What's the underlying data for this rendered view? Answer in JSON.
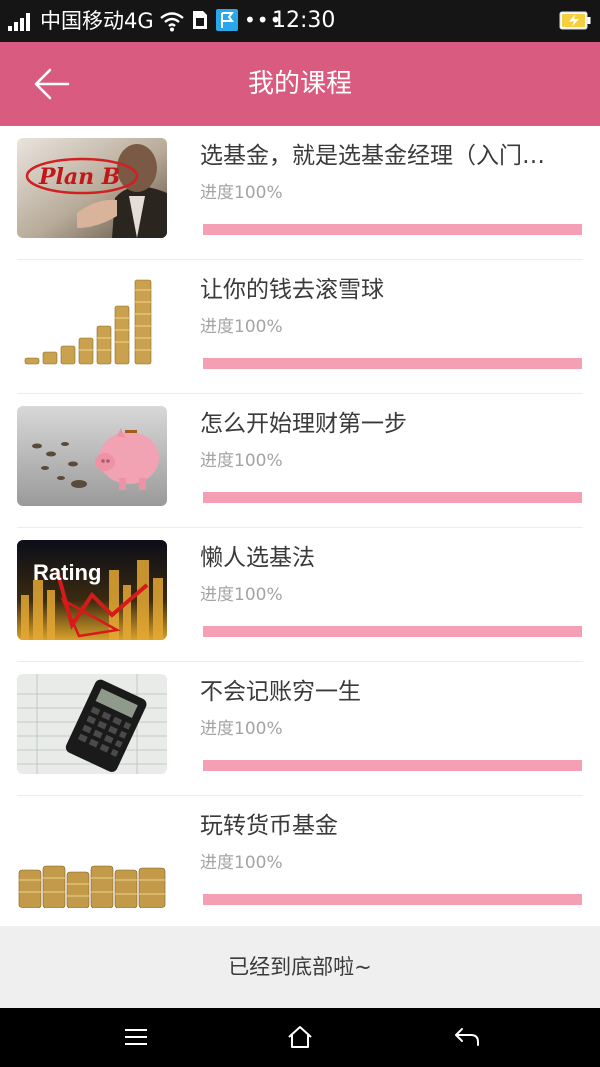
{
  "status_bar": {
    "carrier": "中国移动4G",
    "dots": "•••",
    "time": "12:30"
  },
  "header": {
    "title": "我的课程",
    "back_icon": "arrow-left-icon"
  },
  "courses": [
    {
      "title": "选基金，就是选基金经理（入门…",
      "progress_text": "进度100%",
      "progress": 1.0,
      "thumb_icon": "plan-b-thumbnail",
      "thumb_text": "Plan B"
    },
    {
      "title": "让你的钱去滚雪球",
      "progress_text": "进度100%",
      "progress": 1.0,
      "thumb_icon": "coin-stacks-growth-thumbnail"
    },
    {
      "title": "怎么开始理财第一步",
      "progress_text": "进度100%",
      "progress": 1.0,
      "thumb_icon": "piggy-bank-thumbnail"
    },
    {
      "title": " 懒人选基法",
      "progress_text": "进度100%",
      "progress": 1.0,
      "thumb_icon": "rating-chart-thumbnail",
      "thumb_text": "Rating"
    },
    {
      "title": "不会记账穷一生",
      "progress_text": "进度100%",
      "progress": 1.0,
      "thumb_icon": "calculator-thumbnail"
    },
    {
      "title": "玩转货币基金",
      "progress_text": "进度100%",
      "progress": 1.0,
      "thumb_icon": "coin-row-thumbnail"
    }
  ],
  "footer": {
    "end_text": "已经到底部啦~"
  },
  "nav_bar": {
    "icons": [
      "menu-icon",
      "home-icon",
      "back-icon"
    ]
  },
  "colors": {
    "header_bg": "#d95b7f",
    "progress_fill": "#f59fb5",
    "progress_track": "#f1d0dc",
    "footer_bg": "#efefef"
  }
}
